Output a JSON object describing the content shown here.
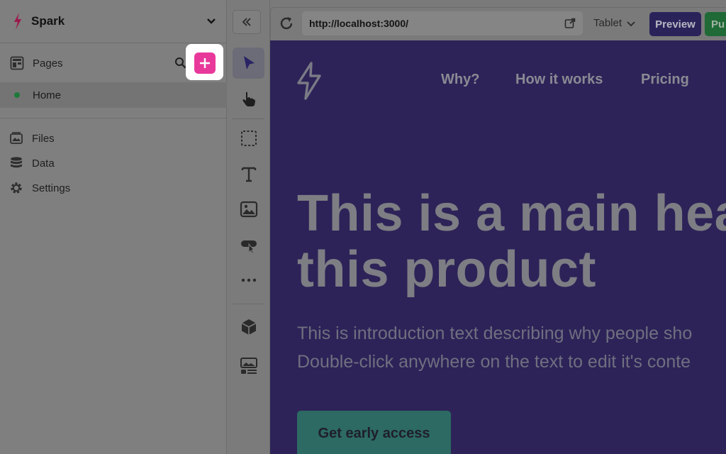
{
  "project": {
    "name": "Spark"
  },
  "sidebar": {
    "pages_label": "Pages",
    "pages": [
      {
        "label": "Home",
        "status_color": "#1e7a3a"
      }
    ],
    "nav": [
      {
        "label": "Files",
        "icon": "files-icon"
      },
      {
        "label": "Data",
        "icon": "database-icon"
      },
      {
        "label": "Settings",
        "icon": "gear-icon"
      }
    ],
    "add_button_color": "#e8399b"
  },
  "toolbar": {
    "tools": [
      "select-arrow-icon",
      "hand-pan-icon",
      "marquee-box-icon",
      "text-icon",
      "image-icon",
      "button-pointer-icon",
      "more-dots-icon",
      "component-cube-icon",
      "media-layout-icon"
    ]
  },
  "browser": {
    "url": "http://localhost:3000/",
    "device": "Tablet",
    "preview_label": "Preview",
    "publish_label": "Pu"
  },
  "site": {
    "nav": [
      "Why?",
      "How it works",
      "Pricing"
    ],
    "headline_line1": "This is a main hea",
    "headline_line2": "this product",
    "intro_line1": "This is introduction text describing why people sho",
    "intro_line2": "Double-click anywhere on the text to edit it's conte",
    "cta_label": "Get early access",
    "bg_color": "#2d2358",
    "cta_color": "#2c6a63"
  }
}
